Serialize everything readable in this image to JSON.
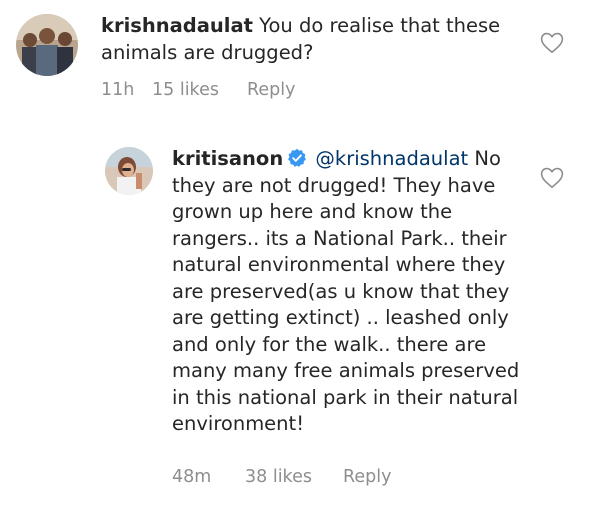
{
  "comments": [
    {
      "username": "krishnadaulat",
      "text": "You do realise that these animals are drugged?",
      "time": "11h",
      "likes": "15 likes",
      "reply_label": "Reply",
      "verified": false,
      "avatar_icon": "avatar-group-photo-icon",
      "like_icon": "heart-outline-icon"
    },
    {
      "username": "kritisanon",
      "mention": "@krishnadaulat",
      "text": "No they are not drugged! They have grown up here and know the rangers.. its a National Park.. their natural environmental where they are preserved(as u know that they are getting extinct) .. leashed only and only for the walk.. there are many many free animals preserved in this national park in their natural environment!",
      "time": "48m",
      "likes": "38 likes",
      "reply_label": "Reply",
      "verified": true,
      "avatar_icon": "avatar-profile-photo-icon",
      "verified_icon": "verified-badge-icon",
      "like_icon": "heart-outline-icon"
    }
  ],
  "colors": {
    "text": "#262626",
    "meta": "#8e8e8e",
    "mention": "#003569",
    "verified": "#3897f0"
  }
}
